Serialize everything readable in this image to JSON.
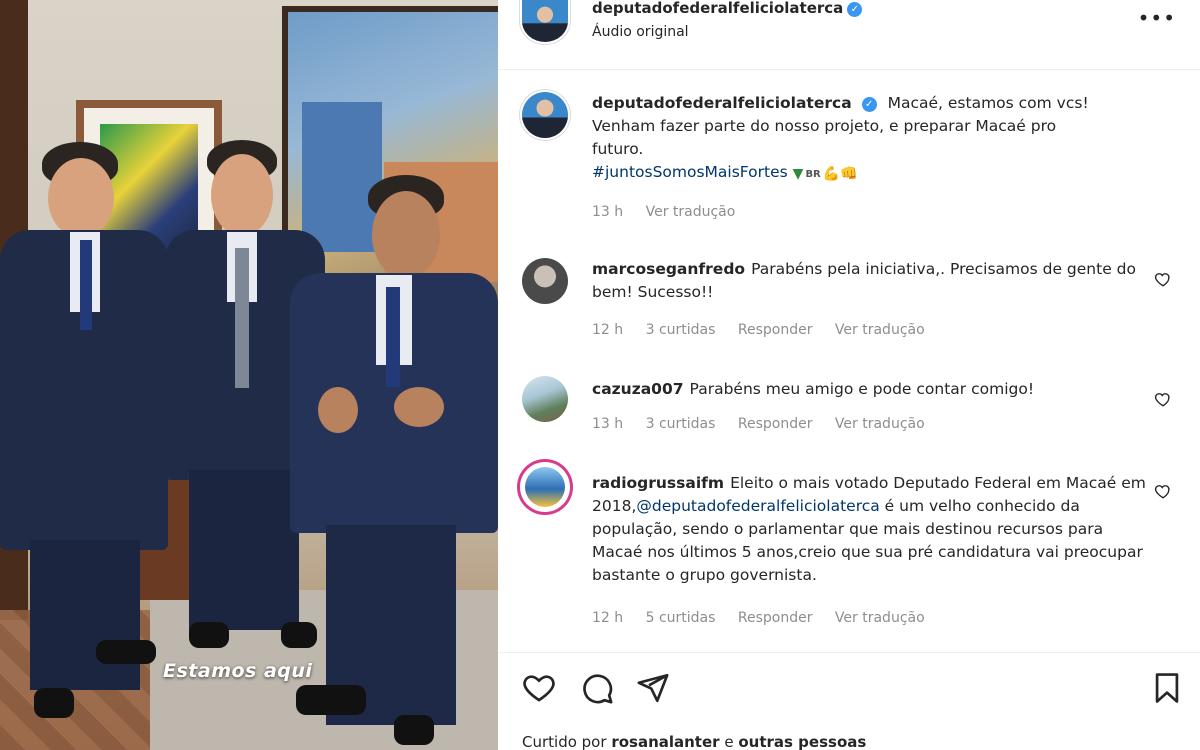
{
  "media": {
    "caption": "Estamos aqui"
  },
  "header": {
    "username": "deputadofederalfeliciolaterca",
    "audio": "Áudio original",
    "more": "•••"
  },
  "post": {
    "username": "deputadofederalfeliciolaterca",
    "text_line1": "Macaé, estamos com vcs!",
    "text_line2": "Venham fazer parte do nosso projeto, e preparar Macaé pro",
    "text_line3": "futuro.",
    "hashtag": "#juntosSomosMaisFortes",
    "emoji_br": "BR",
    "time": "13 h",
    "translate": "Ver tradução"
  },
  "comments": [
    {
      "username": "marcoseganfredo",
      "text": "Parabéns pela iniciativa,. Precisamos de gente do bem! Sucesso!!",
      "time": "12 h",
      "likes": "3 curtidas",
      "reply": "Responder",
      "translate": "Ver tradução"
    },
    {
      "username": "cazuza007",
      "text": "Parabéns meu amigo e pode contar comigo!",
      "time": "13 h",
      "likes": "3 curtidas",
      "reply": "Responder",
      "translate": "Ver tradução"
    },
    {
      "username": "radiogrussaifm",
      "text_before": "Eleito o mais votado Deputado Federal em Macaé em 2018,",
      "mention": "@deputadofederalfeliciolaterca",
      "text_after": " é um velho conhecido da população, sendo o parlamentar que mais destinou recursos para Macaé nos últimos 5 anos,creio que sua pré candidatura vai preocupar bastante o grupo governista.",
      "time": "12 h",
      "likes": "5 curtidas",
      "reply": "Responder",
      "translate": "Ver tradução"
    }
  ],
  "footer": {
    "liked_prefix": "Curtido por",
    "liked_user": "rosanalanter",
    "liked_suffix": "e",
    "liked_others": "outras pessoas"
  },
  "icons": {
    "like": "heart-icon",
    "comment": "comment-icon",
    "share": "share-icon",
    "save": "bookmark-icon",
    "verified": "verified-badge-icon"
  },
  "colors": {
    "verified": "#3897f0",
    "link": "#00376b",
    "muted": "#8e8e8e"
  }
}
